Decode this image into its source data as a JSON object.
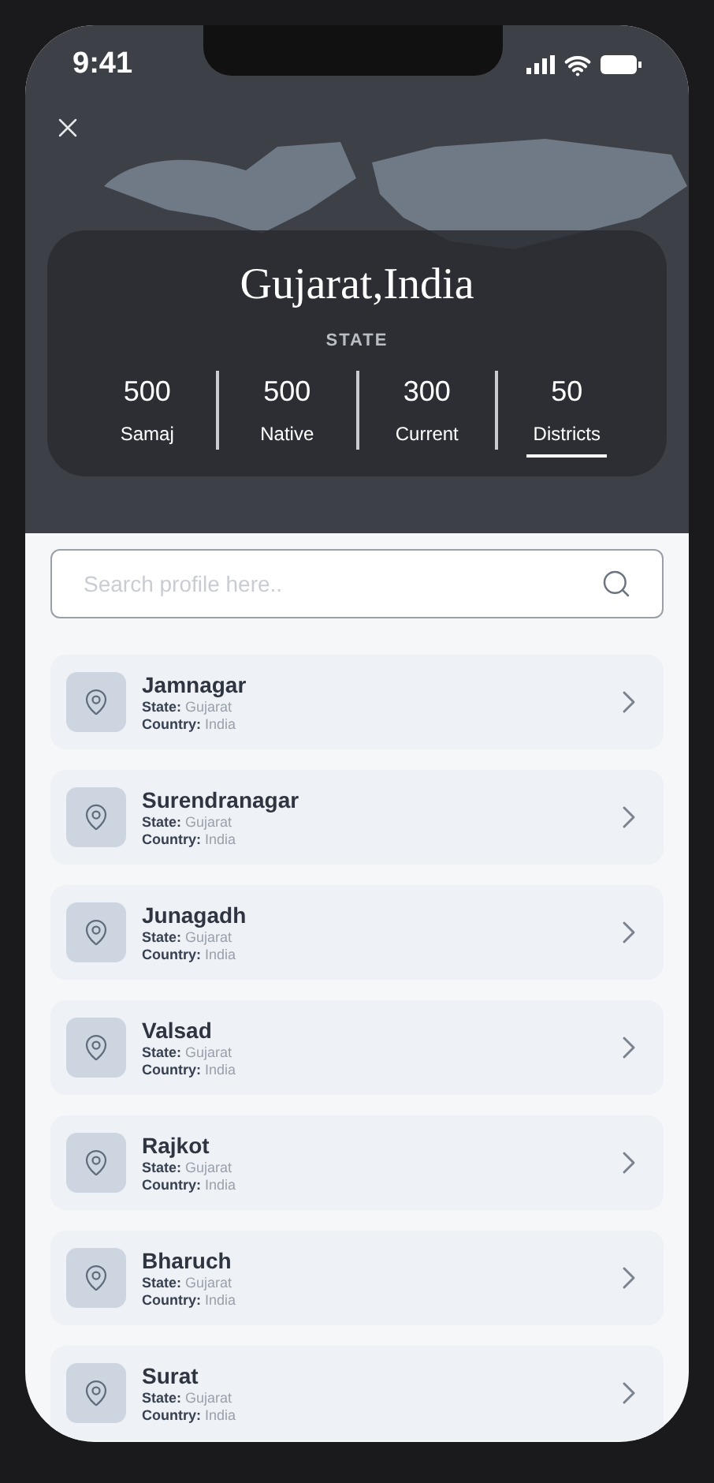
{
  "status_bar": {
    "time": "9:41"
  },
  "header": {
    "title": "Gujarat,India",
    "subtitle": "STATE"
  },
  "stats": [
    {
      "value": "500",
      "label": "Samaj",
      "selected": false
    },
    {
      "value": "500",
      "label": "Native",
      "selected": false
    },
    {
      "value": "300",
      "label": "Current",
      "selected": false
    },
    {
      "value": "50",
      "label": "Districts",
      "selected": true
    }
  ],
  "search": {
    "placeholder": "Search profile here.."
  },
  "districts": [
    {
      "name": "Jamnagar",
      "state_label": "State:",
      "state": "Gujarat",
      "country_label": "Country:",
      "country": "India"
    },
    {
      "name": "Surendranagar",
      "state_label": "State:",
      "state": "Gujarat",
      "country_label": "Country:",
      "country": "India"
    },
    {
      "name": "Junagadh",
      "state_label": "State:",
      "state": "Gujarat",
      "country_label": "Country:",
      "country": "India"
    },
    {
      "name": "Valsad",
      "state_label": "State:",
      "state": "Gujarat",
      "country_label": "Country:",
      "country": "India"
    },
    {
      "name": "Rajkot",
      "state_label": "State:",
      "state": "Gujarat",
      "country_label": "Country:",
      "country": "India"
    },
    {
      "name": "Bharuch",
      "state_label": "State:",
      "state": "Gujarat",
      "country_label": "Country:",
      "country": "India"
    },
    {
      "name": "Surat",
      "state_label": "State:",
      "state": "Gujarat",
      "country_label": "Country:",
      "country": "India"
    }
  ]
}
